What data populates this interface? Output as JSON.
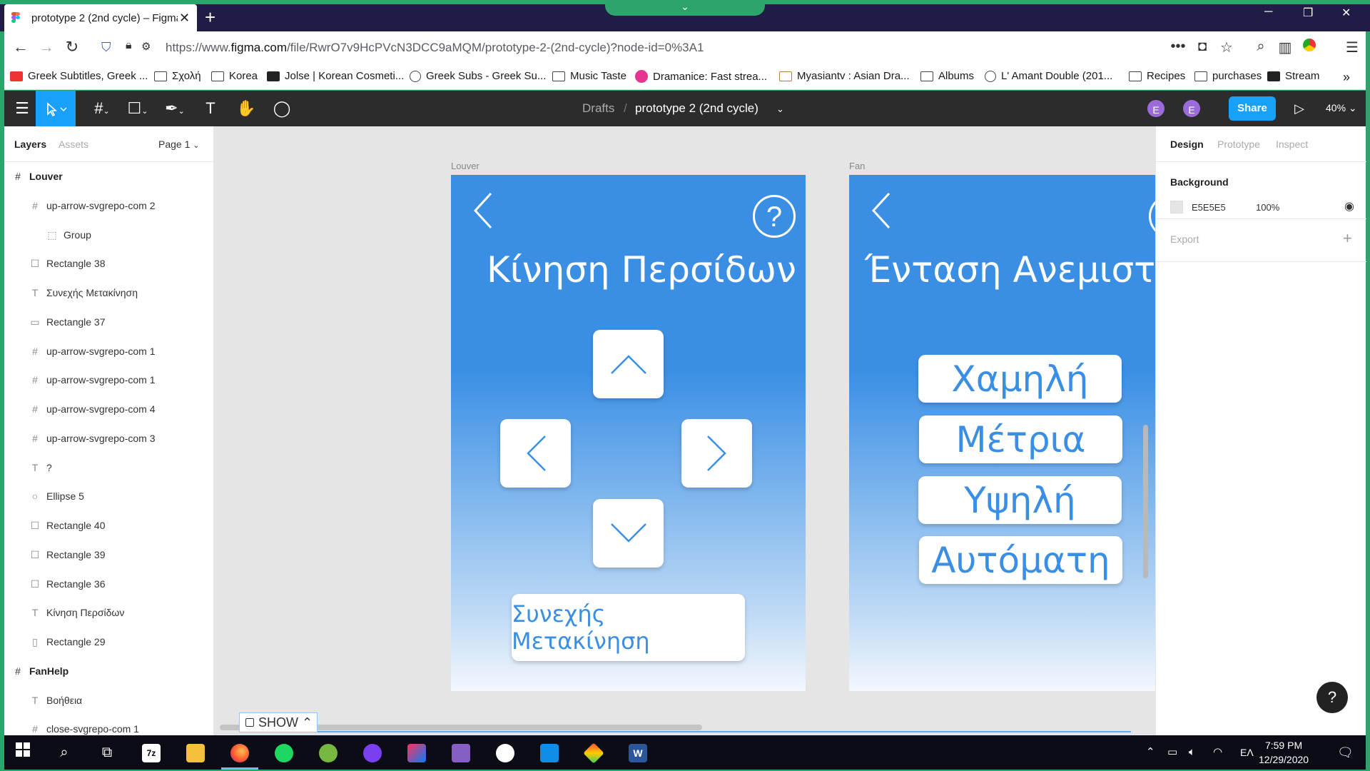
{
  "browser": {
    "tab_title": "prototype 2 (2nd cycle) – Figma",
    "new_tab": "+",
    "url_host_prefix": "https://www.",
    "url_host": "figma.com",
    "url_path": "/file/RwrO7v9HcPVcN3DCC9aMQM/prototype-2-(2nd-cycle)?node-id=0%3A1",
    "bookmarks": [
      {
        "label": "Greek Subtitles, Greek ...",
        "icon": "subs-favicon"
      },
      {
        "label": "Σχολή",
        "icon": "folder-icon"
      },
      {
        "label": "Korea",
        "icon": "folder-icon"
      },
      {
        "label": "Jolse | Korean Cosmeti...",
        "icon": "heart-favicon"
      },
      {
        "label": "Greek Subs - Greek Su...",
        "icon": "search-favicon"
      },
      {
        "label": "Music Taste",
        "icon": "folder-icon"
      },
      {
        "label": "Dramanice: Fast strea...",
        "icon": "dramanice-favicon"
      },
      {
        "label": "Myasiantv : Asian Dra...",
        "icon": "tv-favicon"
      },
      {
        "label": "Albums",
        "icon": "folder-icon"
      },
      {
        "label": "L' Amant Double (201...",
        "icon": "globe-icon"
      },
      {
        "label": "Recipes",
        "icon": "folder-icon"
      },
      {
        "label": "purchases",
        "icon": "folder-icon"
      },
      {
        "label": "Stream",
        "icon": "stream-favicon"
      }
    ]
  },
  "figma": {
    "breadcrumb_root": "Drafts",
    "breadcrumb_sep": "/",
    "file_name": "prototype 2 (2nd cycle)",
    "avatar_1": "E",
    "avatar_2": "E",
    "share_label": "Share",
    "zoom": "40%"
  },
  "left_panel": {
    "tab_layers": "Layers",
    "tab_assets": "Assets",
    "page_label": "Page 1",
    "layers": [
      {
        "name": "Louver",
        "type": "frame",
        "indent": 0
      },
      {
        "name": "up-arrow-svgrepo-com 2",
        "type": "frame",
        "indent": 1
      },
      {
        "name": "Group",
        "type": "group",
        "indent": 2
      },
      {
        "name": "Rectangle 38",
        "type": "rect",
        "indent": 1
      },
      {
        "name": "Συνεχής Μετακίνηση",
        "type": "text",
        "indent": 1
      },
      {
        "name": "Rectangle 37",
        "type": "line",
        "indent": 1
      },
      {
        "name": "up-arrow-svgrepo-com 1",
        "type": "frame",
        "indent": 1
      },
      {
        "name": "up-arrow-svgrepo-com 1",
        "type": "frame",
        "indent": 1
      },
      {
        "name": "up-arrow-svgrepo-com 4",
        "type": "frame",
        "indent": 1
      },
      {
        "name": "up-arrow-svgrepo-com 3",
        "type": "frame",
        "indent": 1
      },
      {
        "name": "?",
        "type": "text",
        "indent": 1
      },
      {
        "name": "Ellipse 5",
        "type": "ellipse",
        "indent": 1
      },
      {
        "name": "Rectangle 40",
        "type": "rect",
        "indent": 1
      },
      {
        "name": "Rectangle 39",
        "type": "rect",
        "indent": 1
      },
      {
        "name": "Rectangle 36",
        "type": "rect",
        "indent": 1
      },
      {
        "name": "Κίνηση Περσίδων",
        "type": "text",
        "indent": 1
      },
      {
        "name": "Rectangle 29",
        "type": "rect-tall",
        "indent": 1
      },
      {
        "name": "FanHelp",
        "type": "frame",
        "indent": 0
      },
      {
        "name": "Βοήθεια",
        "type": "text",
        "indent": 1
      },
      {
        "name": "close-svgrepo-com 1",
        "type": "frame",
        "indent": 1
      }
    ]
  },
  "canvas": {
    "frame_louver_label": "Louver",
    "frame_fan_label": "Fan",
    "louver_title": "Κίνηση Περσίδων",
    "louver_help": "?",
    "louver_continuous": "Συνεχής Μετακίνηση",
    "fan_title": "Ένταση Ανεμιστήρα",
    "fan_options": [
      "Χαμηλή",
      "Μέτρια",
      "Υψηλή",
      "Αυτόματη"
    ],
    "show_label": "SHOW"
  },
  "right_panel": {
    "tab_design": "Design",
    "tab_prototype": "Prototype",
    "tab_inspect": "Inspect",
    "background_label": "Background",
    "background_hex": "E5E5E5",
    "background_opacity": "100%",
    "export_label": "Export",
    "help": "?"
  },
  "taskbar": {
    "language": "ΕΛ",
    "time": "7:59 PM",
    "date": "12/29/2020"
  },
  "colors": {
    "figma_blue": "#18a0fb",
    "frame_blue": "#3a8fe5",
    "canvas_bg": "#E5E5E5",
    "border_green": "#2ea46d"
  }
}
